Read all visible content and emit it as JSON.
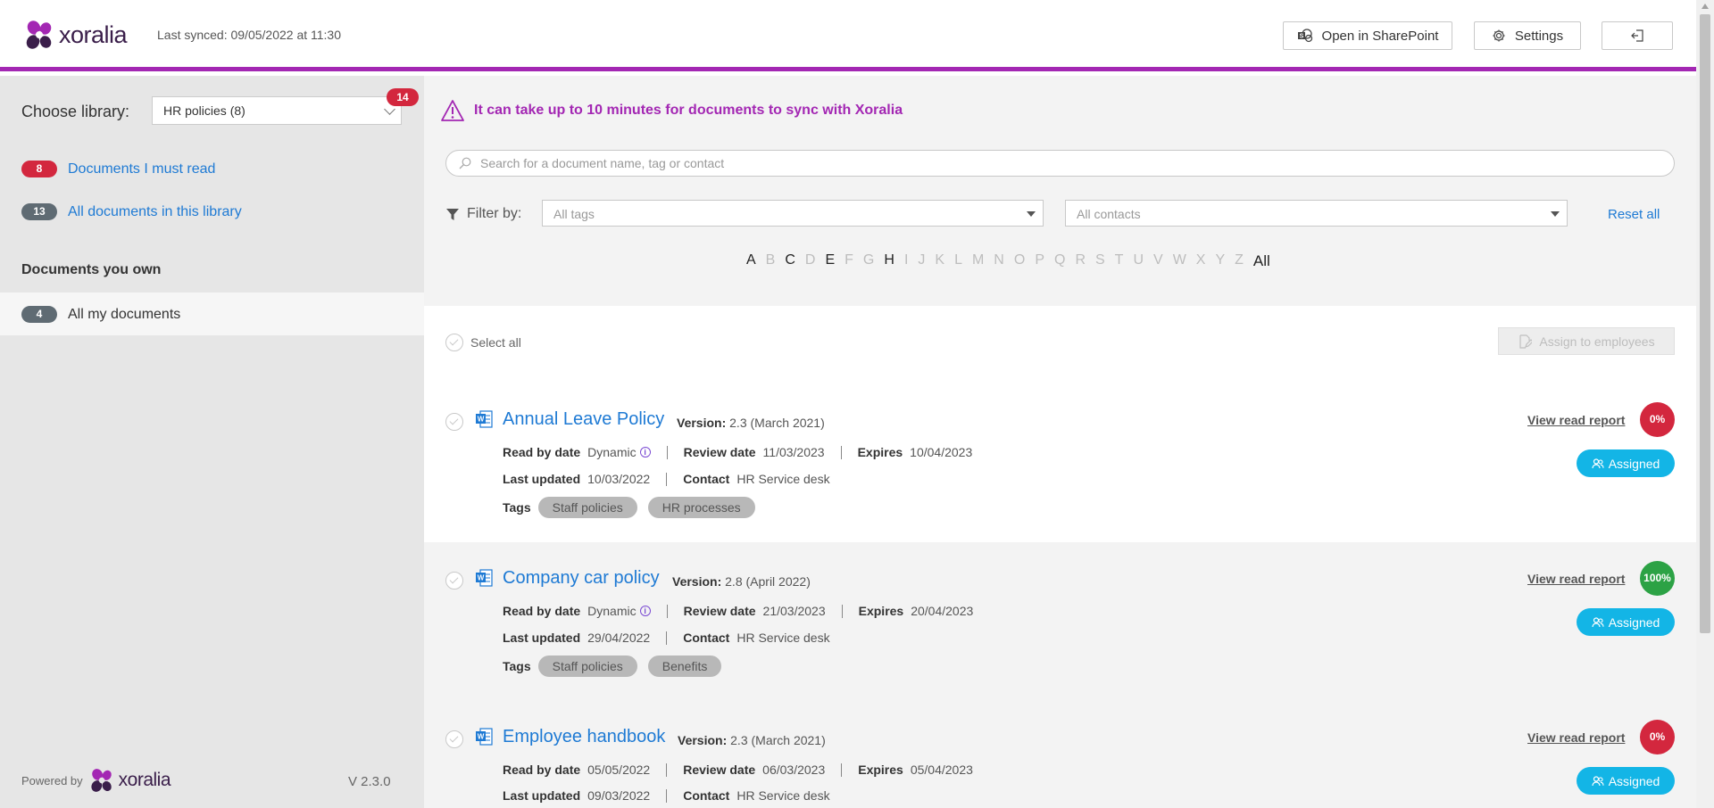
{
  "header": {
    "brand": "xoralia",
    "last_synced": "Last synced: 09/05/2022 at 11:30",
    "open_sharepoint": "Open in SharePoint",
    "settings": "Settings"
  },
  "sidebar": {
    "choose_label": "Choose library:",
    "library_value": "HR policies (8)",
    "library_badge": "14",
    "links": [
      {
        "count": "8",
        "label": "Documents I must read"
      },
      {
        "count": "13",
        "label": "All documents in this library"
      }
    ],
    "owned_title": "Documents you own",
    "owned": {
      "count": "4",
      "label": "All my documents"
    },
    "powered_by": "Powered by",
    "version": "V 2.3.0"
  },
  "main": {
    "warning": "It can take up to 10 minutes for documents to sync with Xoralia",
    "search_placeholder": "Search for a document name, tag or contact",
    "filter_label": "Filter by:",
    "tags_placeholder": "All tags",
    "contacts_placeholder": "All contacts",
    "reset": "Reset all",
    "alphabet": [
      "A",
      "B",
      "C",
      "D",
      "E",
      "F",
      "G",
      "H",
      "I",
      "J",
      "K",
      "L",
      "M",
      "N",
      "O",
      "P",
      "Q",
      "R",
      "S",
      "T",
      "U",
      "V",
      "W",
      "X",
      "Y",
      "Z"
    ],
    "alphabet_active": [
      "A",
      "C",
      "E",
      "H"
    ],
    "alphabet_all": "All",
    "select_all": "Select all",
    "assign_button": "Assign to employees"
  },
  "labels": {
    "version": "Version:",
    "read_by": "Read by date",
    "review": "Review date",
    "expires": "Expires",
    "last_updated": "Last updated",
    "contact": "Contact",
    "tags": "Tags",
    "view_report": "View read report",
    "assigned": "Assigned"
  },
  "documents": [
    {
      "title": "Annual Leave Policy",
      "version": "2.3 (March 2021)",
      "read_by": "Dynamic",
      "review": "11/03/2023",
      "expires": "10/04/2023",
      "last_updated": "10/03/2022",
      "contact": "HR Service desk",
      "tags": [
        "Staff policies",
        "HR processes"
      ],
      "percent": "0%",
      "percent_color": "#d3273e"
    },
    {
      "title": "Company car policy",
      "version": "2.8 (April 2022)",
      "read_by": "Dynamic",
      "review": "21/03/2023",
      "expires": "20/04/2023",
      "last_updated": "29/04/2022",
      "contact": "HR Service desk",
      "tags": [
        "Staff policies",
        "Benefits"
      ],
      "percent": "100%",
      "percent_color": "#2ca245"
    },
    {
      "title": "Employee handbook",
      "version": "2.3 (March 2021)",
      "read_by": "05/05/2022",
      "review": "06/03/2023",
      "expires": "05/04/2023",
      "last_updated": "09/03/2022",
      "contact": "HR Service desk",
      "tags": [],
      "percent": "0%",
      "percent_color": "#d3273e"
    }
  ],
  "colors": {
    "brand_purple": "#a327b3",
    "link_blue": "#1e7ad4",
    "badge_red": "#d3273e",
    "assigned_cyan": "#13b5e6"
  },
  "icons": [
    "xoralia-logo",
    "sharepoint-icon",
    "gear-icon",
    "exit-icon",
    "warning-icon",
    "search-icon",
    "filter-icon",
    "word-doc-icon",
    "info-icon",
    "users-icon",
    "edit-icon",
    "check-circle-icon"
  ]
}
